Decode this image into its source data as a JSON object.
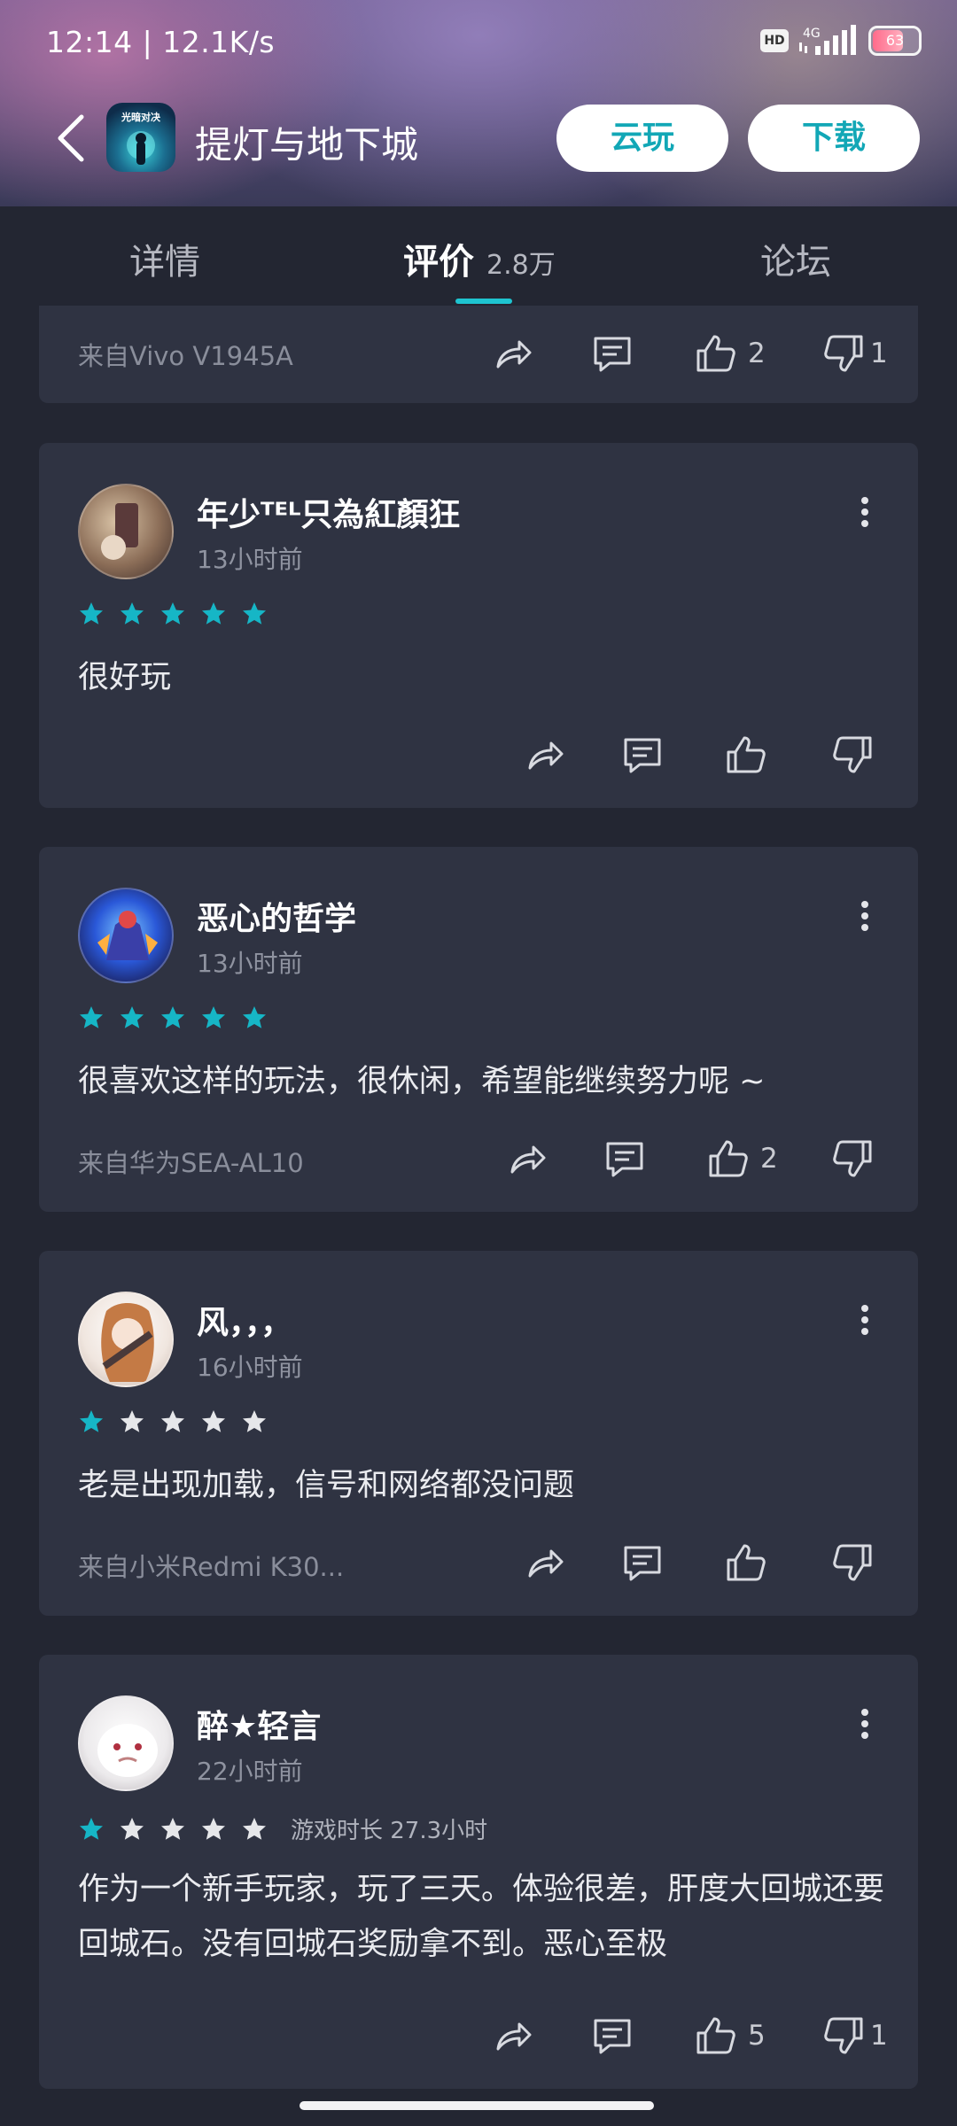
{
  "status_bar": {
    "time_speed": "12:14 | 12.1K/s",
    "hd": "HD",
    "network": "4G",
    "battery": "63"
  },
  "appbar": {
    "app_icon_text": "光暗对决",
    "title": "提灯与地下城",
    "cloud_play": "云玩",
    "download": "下载"
  },
  "tabs": {
    "details": "详情",
    "reviews": "评价",
    "reviews_count": "2.8万",
    "forum": "论坛"
  },
  "reviews": [
    {
      "device": "来自Vivo V1945A",
      "likes": "2",
      "dislikes": "1"
    },
    {
      "user": "年少ᵀᴱᴸ只為紅顏狂",
      "time": "13小时前",
      "stars": 5,
      "text": "很好玩",
      "device": "",
      "likes": "",
      "dislikes": ""
    },
    {
      "user": "恶心的哲学",
      "time": "13小时前",
      "stars": 5,
      "text": "很喜欢这样的玩法，很休闲，希望能继续努力呢 ~",
      "device": "来自华为SEA-AL10",
      "likes": "2",
      "dislikes": ""
    },
    {
      "user": "风，，，",
      "time": "16小时前",
      "stars": 1,
      "text": "老是出现加载，信号和网络都没问题",
      "device": "来自小米Redmi K30...",
      "likes": "",
      "dislikes": ""
    },
    {
      "user": "醉★轻言",
      "time": "22小时前",
      "stars": 1,
      "playtime": "游戏时长 27.3小时",
      "text": "作为一个新手玩家，玩了三天。体验很差，肝度大回城还要回城石。没有回城石奖励拿不到。恶心至极",
      "likes": "5",
      "dislikes": "1"
    }
  ],
  "colors": {
    "accent": "#1ec4d0",
    "star_on": "#16b6c6",
    "star_off": "#e6e7ea",
    "card_bg": "#2f3342",
    "page_bg": "#232632"
  }
}
